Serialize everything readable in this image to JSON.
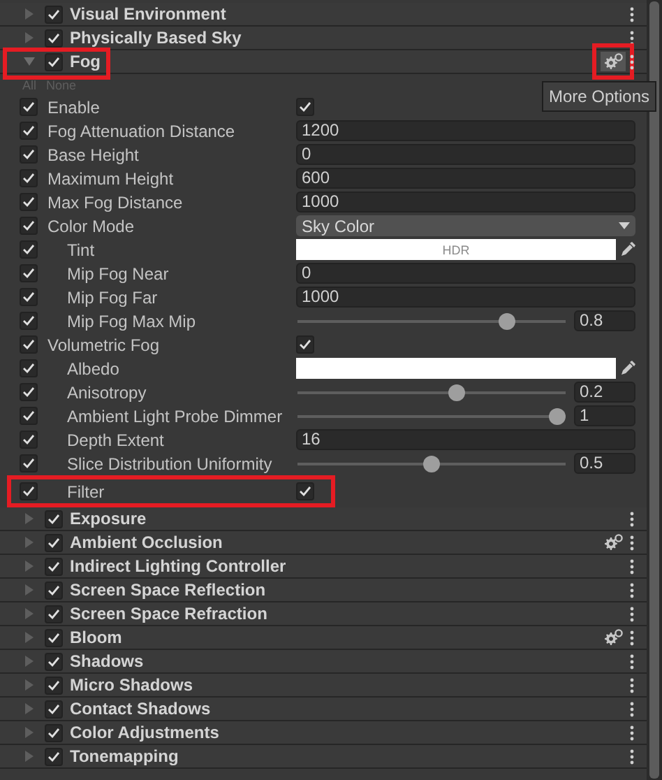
{
  "components": [
    {
      "title": "Visual Environment",
      "enabled": true,
      "expanded": false,
      "gear": false,
      "highlighted": false,
      "gear_highlighted": false
    },
    {
      "title": "Physically Based Sky",
      "enabled": true,
      "expanded": false,
      "gear": false,
      "highlighted": false,
      "gear_highlighted": false
    },
    {
      "title": "Fog",
      "enabled": true,
      "expanded": true,
      "gear": true,
      "highlighted": true,
      "gear_highlighted": true,
      "tooltip": "More Options",
      "quick_select": [
        "All",
        "None"
      ],
      "properties": [
        {
          "label": "Enable",
          "overridden": true,
          "kind": "toggle",
          "checked": true,
          "highlighted": false
        },
        {
          "label": "Fog Attenuation Distance",
          "overridden": true,
          "kind": "number",
          "value": "1200",
          "highlighted": false
        },
        {
          "label": "Base Height",
          "overridden": true,
          "kind": "number",
          "value": "0",
          "highlighted": false
        },
        {
          "label": "Maximum Height",
          "overridden": true,
          "kind": "number",
          "value": "600",
          "highlighted": false
        },
        {
          "label": "Max Fog Distance",
          "overridden": true,
          "kind": "number",
          "value": "1000",
          "highlighted": false
        },
        {
          "label": "Color Mode",
          "overridden": true,
          "kind": "dropdown",
          "value": "Sky Color",
          "highlighted": false,
          "children": [
            {
              "label": "Tint",
              "overridden": true,
              "kind": "color",
              "color": "#ffffff",
              "badge": "HDR",
              "highlighted": false
            },
            {
              "label": "Mip Fog Near",
              "overridden": true,
              "kind": "number",
              "value": "0",
              "highlighted": false
            },
            {
              "label": "Mip Fog Far",
              "overridden": true,
              "kind": "number",
              "value": "1000",
              "highlighted": false
            },
            {
              "label": "Mip Fog Max Mip",
              "overridden": true,
              "kind": "slider",
              "level": 0.8,
              "reading": "0.8",
              "highlighted": false
            }
          ]
        },
        {
          "label": "Volumetric Fog",
          "overridden": true,
          "kind": "toggle",
          "checked": true,
          "highlighted": false,
          "children": [
            {
              "label": "Albedo",
              "overridden": true,
              "kind": "color",
              "color": "#ffffff",
              "highlighted": false
            },
            {
              "label": "Anisotropy",
              "overridden": true,
              "kind": "slider",
              "level": 0.6,
              "reading": "0.2",
              "highlighted": false
            },
            {
              "label": "Ambient Light Probe Dimmer",
              "overridden": true,
              "kind": "slider",
              "level": 1,
              "reading": "1",
              "highlighted": false
            },
            {
              "label": "Depth Extent",
              "overridden": true,
              "kind": "number",
              "value": "16",
              "highlighted": false
            },
            {
              "label": "Slice Distribution Uniformity",
              "overridden": true,
              "kind": "slider",
              "level": 0.5,
              "reading": "0.5",
              "highlighted": false
            },
            {
              "label": "Filter",
              "overridden": true,
              "kind": "toggle",
              "checked": true,
              "highlighted": true
            }
          ]
        }
      ]
    },
    {
      "title": "Exposure",
      "enabled": true,
      "expanded": false,
      "gear": false,
      "highlighted": false,
      "gear_highlighted": false
    },
    {
      "title": "Ambient Occlusion",
      "enabled": true,
      "expanded": false,
      "gear": true,
      "highlighted": false,
      "gear_highlighted": false
    },
    {
      "title": "Indirect Lighting Controller",
      "enabled": true,
      "expanded": false,
      "gear": false,
      "highlighted": false,
      "gear_highlighted": false
    },
    {
      "title": "Screen Space Reflection",
      "enabled": true,
      "expanded": false,
      "gear": false,
      "highlighted": false,
      "gear_highlighted": false
    },
    {
      "title": "Screen Space Refraction",
      "enabled": true,
      "expanded": false,
      "gear": false,
      "highlighted": false,
      "gear_highlighted": false
    },
    {
      "title": "Bloom",
      "enabled": true,
      "expanded": false,
      "gear": true,
      "highlighted": false,
      "gear_highlighted": false
    },
    {
      "title": "Shadows",
      "enabled": true,
      "expanded": false,
      "gear": false,
      "highlighted": false,
      "gear_highlighted": false
    },
    {
      "title": "Micro Shadows",
      "enabled": true,
      "expanded": false,
      "gear": false,
      "highlighted": false,
      "gear_highlighted": false
    },
    {
      "title": "Contact Shadows",
      "enabled": true,
      "expanded": false,
      "gear": false,
      "highlighted": false,
      "gear_highlighted": false
    },
    {
      "title": "Color Adjustments",
      "enabled": true,
      "expanded": false,
      "gear": false,
      "highlighted": false,
      "gear_highlighted": false
    },
    {
      "title": "Tonemapping",
      "enabled": true,
      "expanded": false,
      "gear": false,
      "highlighted": false,
      "gear_highlighted": false
    }
  ]
}
